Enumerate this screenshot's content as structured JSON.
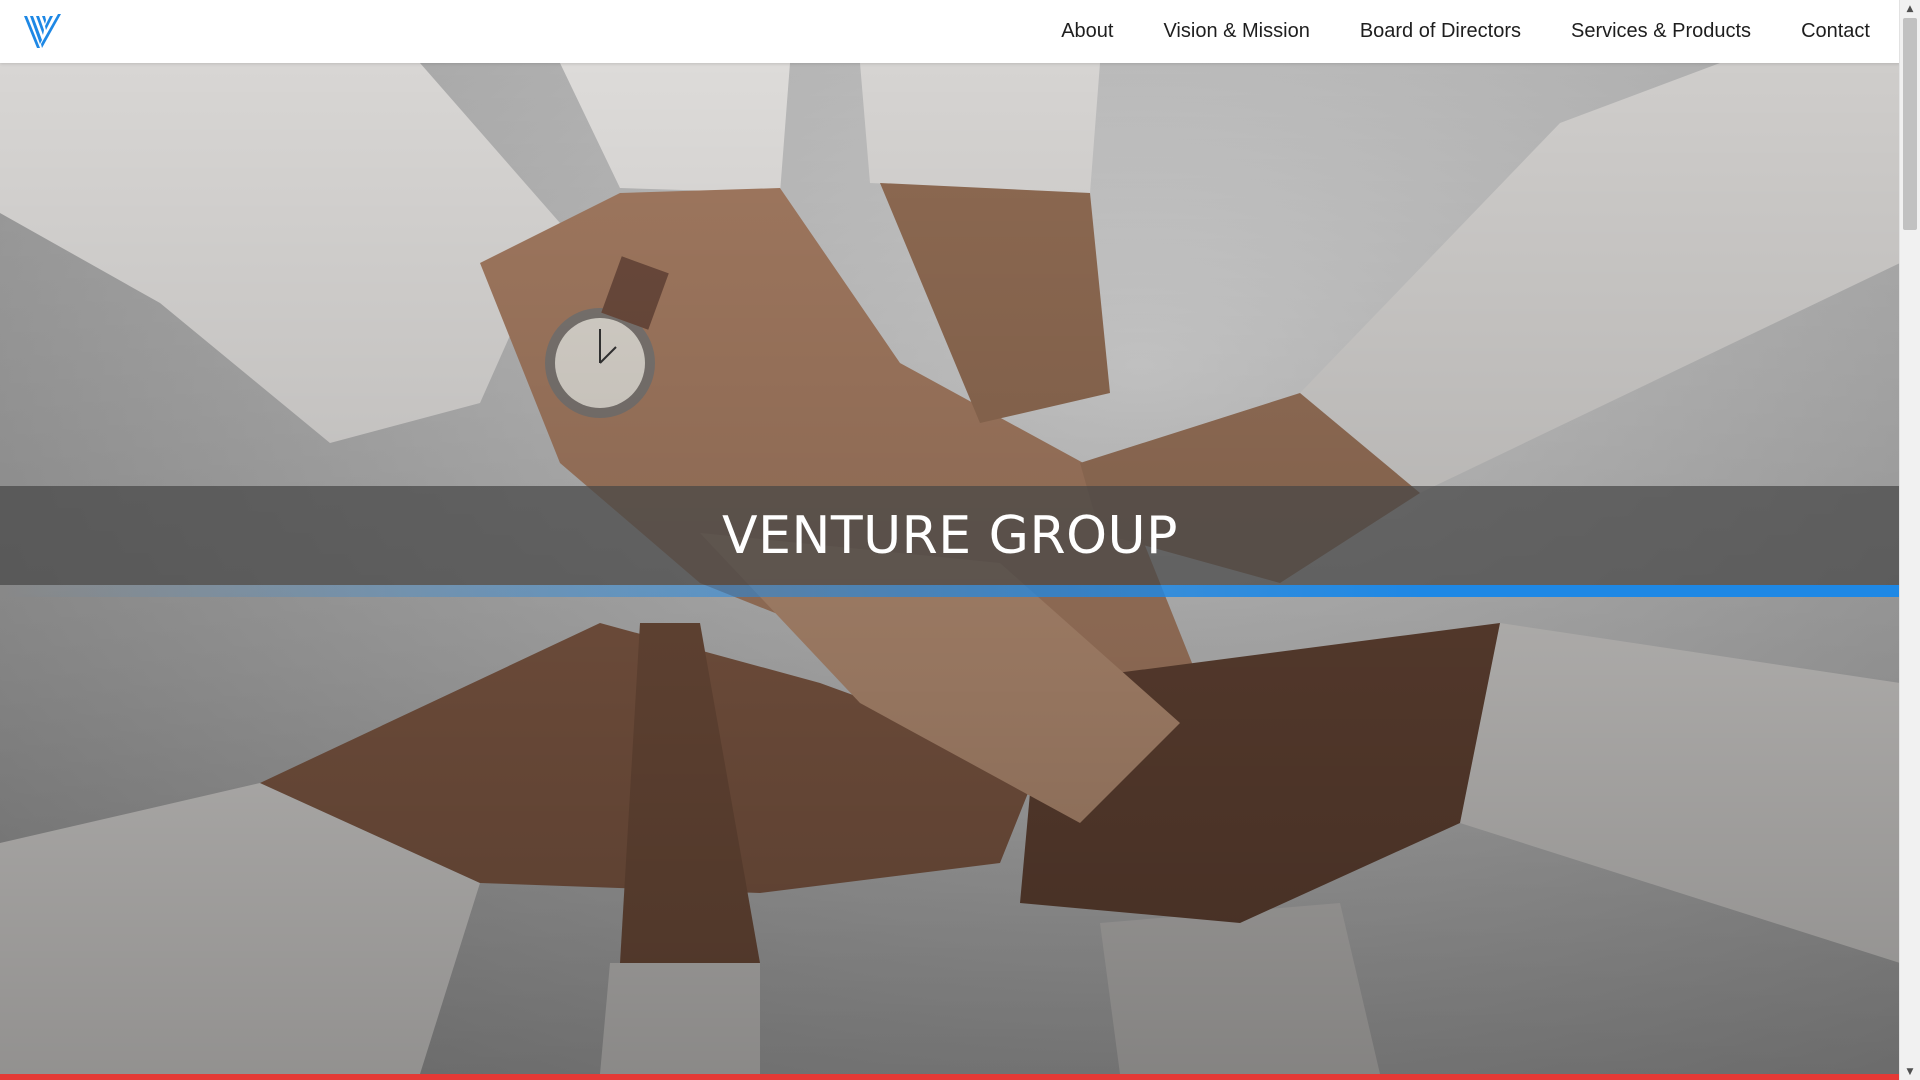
{
  "header": {
    "logo_icon": "venture-v-stripes-icon",
    "nav": [
      {
        "label": "About"
      },
      {
        "label": "Vision & Mission"
      },
      {
        "label": "Board of Directors"
      },
      {
        "label": "Services & Products"
      },
      {
        "label": "Contact"
      }
    ]
  },
  "hero": {
    "title": "VENTURE GROUP",
    "image_subject": "hands-stacked-teamwork-photo"
  },
  "colors": {
    "accent_blue": "#1e88e5",
    "accent_red": "#e53935",
    "band_overlay": "#464646",
    "nav_text": "#1e1e1e"
  },
  "scrollbar": {
    "up_icon": "scroll-up-arrow-icon",
    "down_icon": "scroll-down-arrow-icon"
  }
}
